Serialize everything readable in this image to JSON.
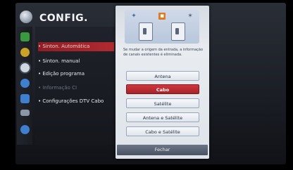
{
  "header": {
    "title": "CONFIG."
  },
  "menu": {
    "items": [
      {
        "label": "• Sinton. Automática",
        "state": "selected"
      },
      {
        "label": "• Sinton. manual",
        "state": "normal"
      },
      {
        "label": "• Edição programa",
        "state": "normal"
      },
      {
        "label": "• Informação CI",
        "state": "disabled"
      },
      {
        "label": "• Configurações DTV Cabo",
        "state": "normal"
      }
    ]
  },
  "dialog": {
    "notice": "Se mudar a origem da entrada, a informação de canais existentes é eliminada.",
    "options": [
      {
        "label": "Antena",
        "active": false
      },
      {
        "label": "Cabo",
        "active": true
      },
      {
        "label": "Satélite",
        "active": false
      },
      {
        "label": "Antena e Satélite",
        "active": false
      },
      {
        "label": "Cabo e Satélite",
        "active": false
      }
    ],
    "close_label": "Fechar"
  },
  "rail_icons": [
    {
      "name": "picture-icon",
      "color": "#3a9a3e"
    },
    {
      "name": "audio-icon",
      "color": "#c9a227"
    },
    {
      "name": "setup-icon",
      "color": "#cfd6e0"
    },
    {
      "name": "time-icon",
      "color": "#3f7fd0"
    },
    {
      "name": "lock-icon",
      "color": "#3f7fd0"
    },
    {
      "name": "option-icon",
      "color": "#8d96a6"
    },
    {
      "name": "network-icon",
      "color": "#3f7fd0"
    }
  ],
  "colors": {
    "accent": "#b02a30",
    "dialog_bg": "#e8ecf1",
    "close_bg": "#5a6272"
  }
}
